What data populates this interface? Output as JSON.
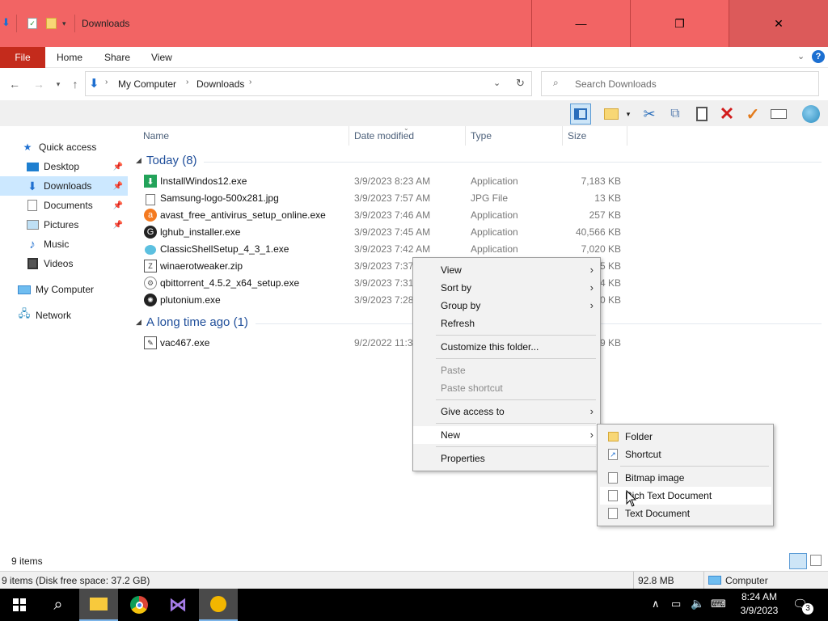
{
  "window": {
    "title": "Downloads",
    "title_color": "#f26464",
    "minimize_glyph": "—",
    "maximize_glyph": "❐",
    "close_glyph": "✕"
  },
  "ribbon": {
    "tabs": [
      "File",
      "Home",
      "Share",
      "View"
    ]
  },
  "address": {
    "path": [
      "My Computer",
      "Downloads"
    ],
    "search_placeholder": "Search Downloads"
  },
  "columns": {
    "name": "Name",
    "date": "Date modified",
    "type": "Type",
    "size": "Size"
  },
  "nav": {
    "items": [
      {
        "label": "Quick access",
        "icon": "star-icon"
      },
      {
        "label": "Desktop",
        "icon": "desktop-icon",
        "pinned": true
      },
      {
        "label": "Downloads",
        "icon": "download-icon",
        "pinned": true,
        "selected": true
      },
      {
        "label": "Documents",
        "icon": "documents-icon",
        "pinned": true
      },
      {
        "label": "Pictures",
        "icon": "pictures-icon",
        "pinned": true
      },
      {
        "label": "Music",
        "icon": "music-icon"
      },
      {
        "label": "Videos",
        "icon": "videos-icon"
      },
      {
        "label": "My Computer",
        "icon": "computer-icon"
      },
      {
        "label": "Network",
        "icon": "network-icon"
      }
    ]
  },
  "groups": [
    {
      "label": "Today (8)",
      "files": [
        {
          "name": "InstallWindos12.exe",
          "date": "3/9/2023 8:23 AM",
          "type": "Application",
          "size": "7,183 KB"
        },
        {
          "name": "Samsung-logo-500x281.jpg",
          "date": "3/9/2023 7:57 AM",
          "type": "JPG File",
          "size": "13 KB"
        },
        {
          "name": "avast_free_antivirus_setup_online.exe",
          "date": "3/9/2023 7:46 AM",
          "type": "Application",
          "size": "257 KB"
        },
        {
          "name": "lghub_installer.exe",
          "date": "3/9/2023 7:45 AM",
          "type": "Application",
          "size": "40,566 KB"
        },
        {
          "name": "ClassicShellSetup_4_3_1.exe",
          "date": "3/9/2023 7:42 AM",
          "type": "Application",
          "size": "7,020 KB"
        },
        {
          "name": "winaerotweaker.zip",
          "date": "3/9/2023 7:37",
          "type": "",
          "size": "95 KB"
        },
        {
          "name": "qbittorrent_4.5.2_x64_setup.exe",
          "date": "3/9/2023 7:31",
          "type": "",
          "size": "74 KB"
        },
        {
          "name": "plutonium.exe",
          "date": "3/9/2023 7:28",
          "type": "",
          "size": "60 KB"
        }
      ]
    },
    {
      "label": "A long time ago (1)",
      "files": [
        {
          "name": "vac467.exe",
          "date": "9/2/2022 11:3",
          "type": "",
          "size": "9 KB"
        }
      ]
    }
  ],
  "context_menu": {
    "items": [
      {
        "label": "View",
        "submenu": true
      },
      {
        "label": "Sort by",
        "submenu": true
      },
      {
        "label": "Group by",
        "submenu": true
      },
      {
        "label": "Refresh"
      },
      {
        "label": "Customize this folder..."
      },
      {
        "label": "Paste",
        "disabled": true
      },
      {
        "label": "Paste shortcut",
        "disabled": true
      },
      {
        "label": "Give access to",
        "submenu": true
      },
      {
        "label": "New",
        "submenu": true,
        "highlighted": true
      },
      {
        "label": "Properties"
      }
    ]
  },
  "new_submenu": {
    "items": [
      {
        "label": "Folder",
        "icon": "folder-icon"
      },
      {
        "label": "Shortcut",
        "icon": "shortcut-icon"
      },
      {
        "label": "Bitmap image",
        "icon": "bitmap-icon"
      },
      {
        "label": "Rich Text Document",
        "icon": "rtf-icon",
        "hovered": true
      },
      {
        "label": "Text Document",
        "icon": "text-icon"
      }
    ]
  },
  "status": {
    "item_count": "9 items",
    "details": "9 items (Disk free space: 37.2 GB)",
    "size": "92.8 MB",
    "location": "Computer"
  },
  "taskbar": {
    "time": "8:24 AM",
    "date": "3/9/2023",
    "notification_count": "3"
  }
}
